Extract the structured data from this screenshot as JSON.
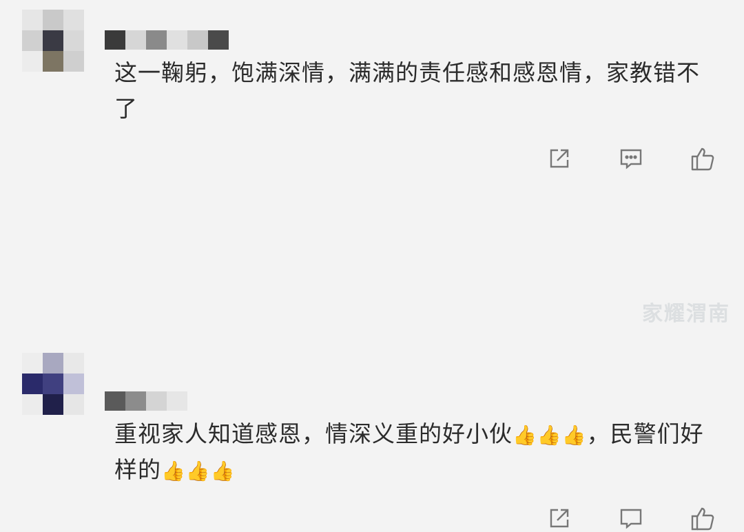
{
  "comments": [
    {
      "text": "这一鞠躬，饱满深情，满满的责任感和感恩情，家教错不了",
      "avatar_colors": [
        "#e6e6e6",
        "#c9c9c9",
        "#e0e0e0",
        "#d0d0d0",
        "#3a3a44",
        "#d8d8d8",
        "#ececec",
        "#7d7563",
        "#cfcfcf"
      ],
      "username_colors": [
        "#3a3a3a",
        "#d6d6d6",
        "#8a8a8a",
        "#e0e0e0",
        "#c8c8c8",
        "#4a4a4a"
      ]
    },
    {
      "text_part1": "重视家人知道感恩，情深义重的好小伙",
      "text_part2": "，民警们好样的",
      "avatar_colors": [
        "#ededed",
        "#a8a8c0",
        "#e8e8e8",
        "#2a2a6a",
        "#404080",
        "#c0c0d8",
        "#ececec",
        "#20204a",
        "#e6e6e6"
      ],
      "username_colors": [
        "#5a5a5a",
        "#8c8c8c",
        "#d4d4d4",
        "#e6e6e6"
      ]
    }
  ],
  "emoji": {
    "thumbs_up": "👍"
  },
  "actions": {
    "share_icon": "share-icon",
    "comment_icon": "comment-icon",
    "like_icon": "like-icon"
  },
  "watermark": "家耀渭南"
}
